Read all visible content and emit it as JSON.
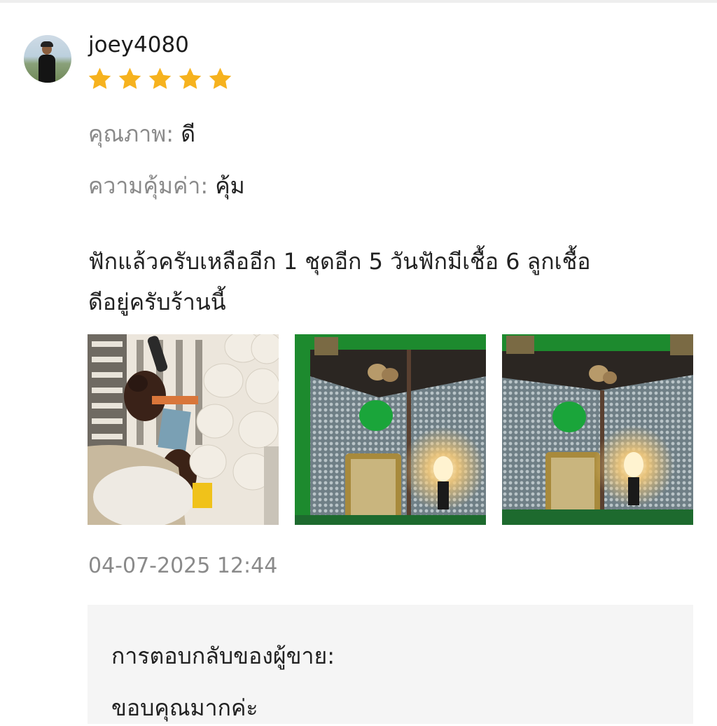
{
  "review": {
    "username": "joey4080",
    "rating": 5,
    "rating_max": 5,
    "star_color": "#F6B21E",
    "attributes": [
      {
        "label": "คุณภาพ:",
        "value": "ดี"
      },
      {
        "label": "ความคุ้มค่า:",
        "value": "คุ้ม"
      }
    ],
    "text_line1": "ฟักแล้วครับเหลืออีก 1 ชุดอีก 5 วันฟักมีเชื้อ 6 ลูกเชื้อ",
    "text_line2": "ดีอยู่ครับร้านนี้",
    "photos": [
      {
        "subject": "chicks-and-eggs-in-incubator-tray"
      },
      {
        "subject": "brooder-with-chicks-and-heat-lamp"
      },
      {
        "subject": "brooder-with-chicks-and-heat-lamp"
      }
    ],
    "timestamp": "04-07-2025 12:44"
  },
  "seller_reply": {
    "title": "การตอบกลับของผู้ขาย:",
    "text": "ขอบคุณมากค่ะ"
  }
}
